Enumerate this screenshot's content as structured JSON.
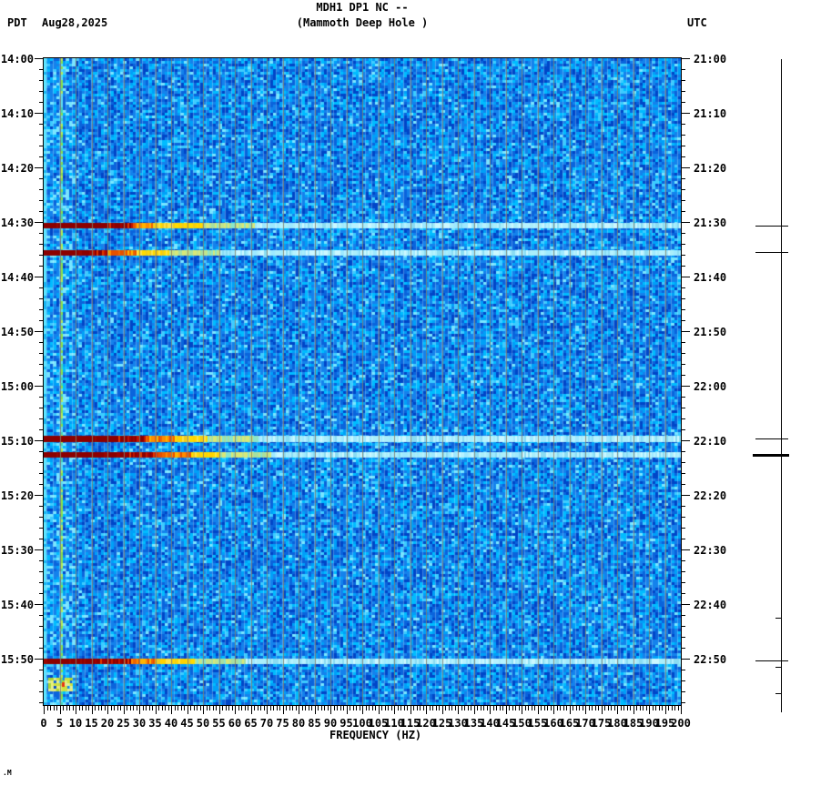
{
  "header": {
    "tz_left": "PDT",
    "date": "Aug28,2025",
    "title": "MDH1 DP1 NC --",
    "subtitle": "(Mammoth Deep Hole )",
    "tz_right": "UTC"
  },
  "corner_mark": ".M",
  "chart_data": {
    "type": "heatmap",
    "subtype": "seismic-spectrogram",
    "title": "MDH1 DP1 NC --",
    "subtitle": "(Mammoth Deep Hole )",
    "xlabel": "FREQUENCY (HZ)",
    "x_range_hz": [
      0,
      200
    ],
    "x_major_tick_step_hz": 5,
    "x_minor_tick_step_hz": 1,
    "x_tick_labels": [
      "0",
      "5",
      "10",
      "15",
      "20",
      "25",
      "30",
      "35",
      "40",
      "45",
      "50",
      "55",
      "60",
      "65",
      "70",
      "75",
      "80",
      "85",
      "90",
      "95",
      "100",
      "105",
      "110",
      "115",
      "120",
      "125",
      "130",
      "135",
      "140",
      "145",
      "150",
      "155",
      "160",
      "165",
      "170",
      "175",
      "180",
      "185",
      "190",
      "195",
      "200"
    ],
    "left_axis": {
      "timezone": "PDT",
      "date": "Aug28,2025",
      "tick_labels": [
        "14:00",
        "14:10",
        "14:20",
        "14:30",
        "14:40",
        "14:50",
        "15:00",
        "15:10",
        "15:20",
        "15:30",
        "15:40",
        "15:50"
      ],
      "major_tick_minutes": 10,
      "minor_tick_minutes": 2
    },
    "right_axis": {
      "timezone": "UTC",
      "tick_labels": [
        "21:00",
        "21:10",
        "21:20",
        "21:30",
        "21:40",
        "21:50",
        "22:00",
        "22:10",
        "22:20",
        "22:30",
        "22:40",
        "22:50"
      ]
    },
    "time_span_minutes": 118,
    "grid": {
      "vertical_every_hz": 5,
      "color": "#82806c"
    },
    "background_noise_palette": [
      "#0046c8",
      "#0a64dc",
      "#1482ec",
      "#00a0f8",
      "#00bcff",
      "#3cccff",
      "#78e6ff"
    ],
    "persistent_tone_hz": 5.5,
    "dc_band_hz": [
      0,
      1
    ],
    "events": [
      {
        "pdt": "14:30",
        "utc": "21:30",
        "t_min": 30.2,
        "darkred_hz": 20,
        "stripe_hz": 28,
        "orange_hz": 34,
        "yellow_hz": 50,
        "h": 6
      },
      {
        "pdt": "14:35",
        "utc": "21:35",
        "t_min": 35.1,
        "darkred_hz": 15,
        "stripe_hz": 20,
        "orange_hz": 29,
        "yellow_hz": 39,
        "h": 6
      },
      {
        "pdt": "15:09",
        "utc": "22:09",
        "t_min": 69.2,
        "darkred_hz": 23,
        "stripe_hz": 32,
        "orange_hz": 41,
        "yellow_hz": 51,
        "h": 7
      },
      {
        "pdt": "15:12",
        "utc": "22:12",
        "t_min": 72.2,
        "darkred_hz": 23,
        "stripe_hz": 36,
        "orange_hz": 46,
        "yellow_hz": 55,
        "h": 6
      },
      {
        "pdt": "15:50",
        "utc": "22:50",
        "t_min": 110.0,
        "darkred_hz": 16,
        "stripe_hz": 27,
        "orange_hz": 35,
        "yellow_hz": 47,
        "h": 6
      }
    ],
    "small_patch": {
      "t_min": 113.6,
      "hz": [
        1.4,
        8.3
      ],
      "color": "yellow-green",
      "red_dot_hz": 6
    },
    "event_band_colors": {
      "darkred": "#8c0000",
      "red": "#d21e00",
      "orange": "#ff7800",
      "yellow": "#ffd700",
      "yellow_green": "#c8e47d",
      "pale_cyan_tail": "#a0ecff"
    },
    "amplitude_trace": {
      "marks": [
        {
          "t_min": 30.5,
          "bold": false
        },
        {
          "t_min": 35.3,
          "bold": false
        },
        {
          "t_min": 69.5,
          "bold": false
        },
        {
          "t_min": 72.5,
          "bold": true
        },
        {
          "t_min": 110.2,
          "bold": false
        }
      ],
      "minor_marks": [
        {
          "t_min": 102.3
        },
        {
          "t_min": 111.4
        },
        {
          "t_min": 116.1
        }
      ]
    }
  }
}
